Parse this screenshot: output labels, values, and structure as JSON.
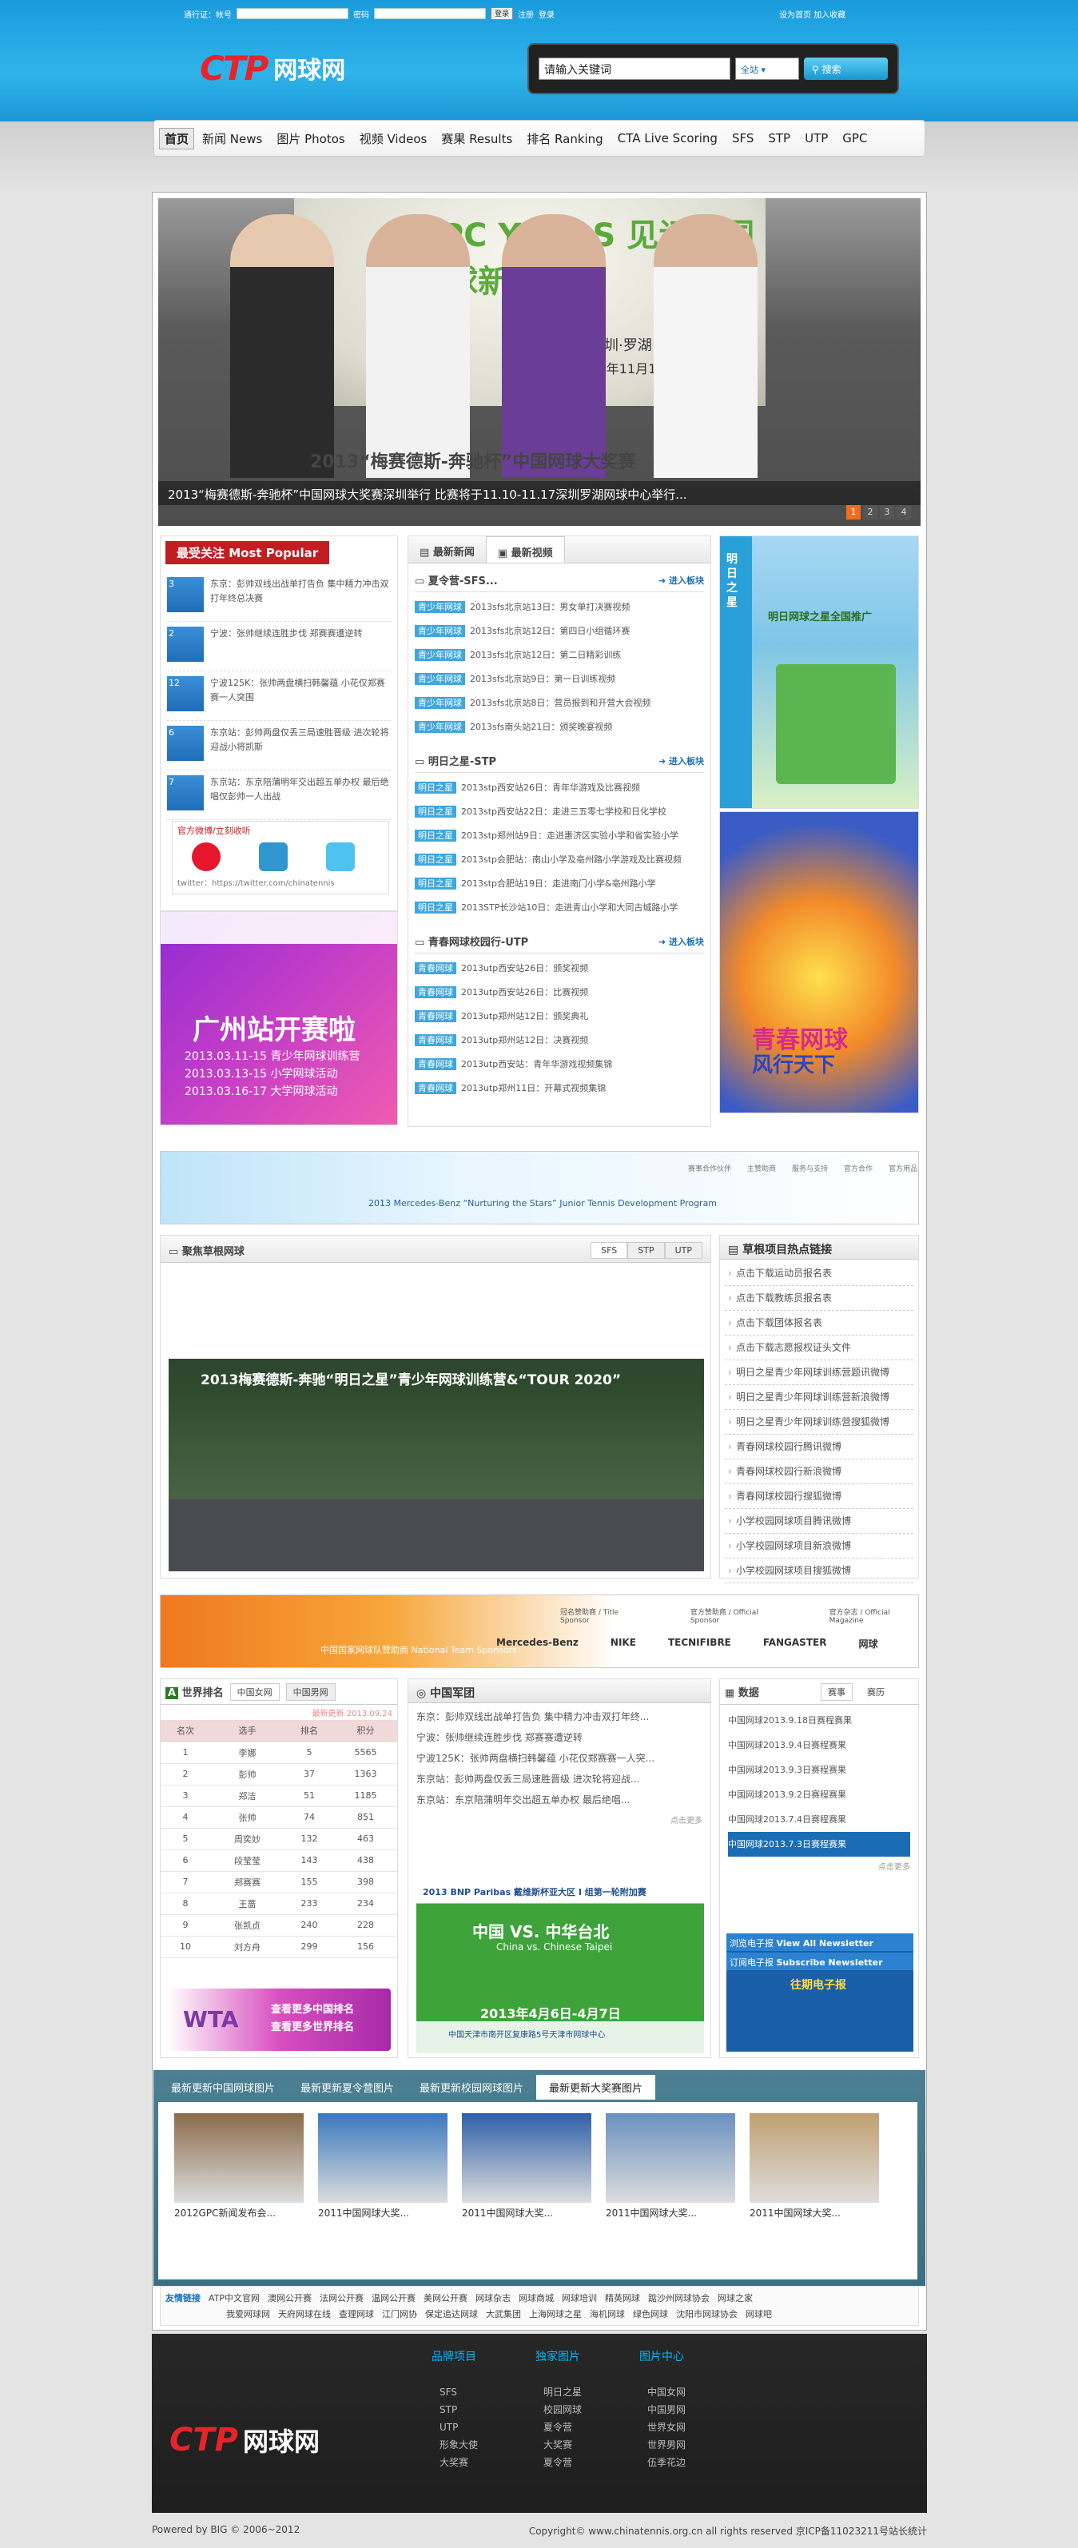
{
  "top": {
    "login_label": "通行证：帐号",
    "password_label": "密码",
    "login_btn": "登录",
    "register": "注册",
    "login": "登录",
    "set_home": "设为首页",
    "add_fav": "加入收藏"
  },
  "logo": {
    "text_ctp": "CTP",
    "text_cn": "网球网"
  },
  "search": {
    "value": "请输入关键词",
    "scope": "全站",
    "button": "搜索"
  },
  "nav": [
    "首页",
    "新闻 News",
    "图片 Photos",
    "视频 Videos",
    "赛果 Results",
    "排名 Ranking",
    "CTA Live Scoring",
    "SFS",
    "STP",
    "UTP",
    "GPC"
  ],
  "slide": {
    "caption": "2013“梅赛德斯-奔驰杯”中国网球大奖赛深圳举行 比赛将于11.10-11.17深圳罗湖网球中心举行...",
    "banner_title": "GPC YEARS 见证中国网球新力量",
    "banner_sub": "深圳·罗湖",
    "banner_date": "2013年11月10日",
    "banner_bottom": "2013“梅赛德斯-奔驰杯”中国网球大奖赛",
    "pages": [
      "1",
      "2",
      "3",
      "4"
    ]
  },
  "popular": {
    "title": "最受关注 Most Popular",
    "items": [
      {
        "num": "3",
        "text": "东京：彭帅双线出战单打告负 集中精力冲击双打年终总决赛"
      },
      {
        "num": "2",
        "text": "宁波：张帅继续连胜步伐 郑赛赛遭逆转"
      },
      {
        "num": "12",
        "text": "宁波125K：张帅两盘横扫韩馨蕴 小花仅郑赛赛一人突围"
      },
      {
        "num": "6",
        "text": "东京站：彭帅两盘仅丢三局速胜晋级 进次轮将迎战小将凯斯"
      },
      {
        "num": "7",
        "text": "东京站：东京陪蒲明年交出超五单办权 最后绝唱仅彭帅一人出战"
      }
    ]
  },
  "weibo": {
    "title": "官方微博/立刻收听",
    "twitter": "twitter：https://twitter.com/chinatennis"
  },
  "guangzhou": {
    "title": "广州站开赛啦",
    "l1": "2013.03.11-15 青少年网球训练营",
    "l2": "2013.03.13-15 小学网球活动",
    "l3": "2013.03.16-17 大学网球活动"
  },
  "center_tabs": {
    "news": "最新新闻",
    "video": "最新视频"
  },
  "sfs": {
    "title": "夏令营-SFS...",
    "enter": "进入板块",
    "rows": [
      {
        "d": "青少年网球",
        "t": "2013sfs北京站13日：男女单打决赛视频"
      },
      {
        "d": "青少年网球",
        "t": "2013sfs北京站12日：第四日小组循环赛"
      },
      {
        "d": "青少年网球",
        "t": "2013sfs北京站12日：第二日精彩训练"
      },
      {
        "d": "青少年网球",
        "t": "2013sfs北京站9日：第一日训练视频"
      },
      {
        "d": "青少年网球",
        "t": "2013sfs北京站8日：营员报到和开营大会视频"
      },
      {
        "d": "青少年网球",
        "t": "2013sfs南头站21日：颁奖晚宴视频"
      }
    ]
  },
  "stp": {
    "title": "明日之星-STP",
    "enter": "进入板块",
    "rows": [
      {
        "d": "明日之星",
        "t": "2013stp西安站26日：青年华游戏及比赛视频"
      },
      {
        "d": "明日之星",
        "t": "2013stp西安站22日：走进三五零七学校和日化学校"
      },
      {
        "d": "明日之星",
        "t": "2013stp郑州站9日：走进惠济区实验小学和省实验小学"
      },
      {
        "d": "明日之星",
        "t": "2013stp会肥站：南山小学及亳州路小学游戏及比赛视频"
      },
      {
        "d": "明日之星",
        "t": "2013stp合肥站19日：走进南门小学&亳州路小学"
      },
      {
        "d": "明日之星",
        "t": "2013STP长沙站10日：走进青山小学和大同古城路小学"
      }
    ]
  },
  "utp": {
    "title": "青春网球校园行-UTP",
    "enter": "进入板块",
    "rows": [
      {
        "d": "青春网球",
        "t": "2013utp西安站26日：颁奖视频"
      },
      {
        "d": "青春网球",
        "t": "2013utp西安站26日：比赛视频"
      },
      {
        "d": "青春网球",
        "t": "2013utp郑州站12日：颁奖典礼"
      },
      {
        "d": "青春网球",
        "t": "2013utp郑州站12日：决赛视频"
      },
      {
        "d": "青春网球",
        "t": "2013utp西安站：青年华游戏视频集锦"
      },
      {
        "d": "青春网球",
        "t": "2013utp郑州11日：开幕式视频集锦"
      }
    ]
  },
  "right_ads": {
    "stp_title": "明日之星",
    "stp_sub": "明日网球之星全国推广",
    "utp_title": "青春网球",
    "utp_title2": "风行天下"
  },
  "sponsor_banner": {
    "text": "2013 Mercedes-Benz “Nurturing the Stars” Junior Tennis Development Program",
    "labels": [
      "赛事合作伙伴",
      "主赞助商",
      "服务与支持",
      "官方合作",
      "官方用品"
    ]
  },
  "focus": {
    "title": "聚焦草根网球",
    "tabs": [
      "SFS",
      "STP",
      "UTP"
    ],
    "image_title": "2013梅赛德斯-奔驰“明日之星”青少年网球训练营&“TOUR 2020”"
  },
  "hot": {
    "title": "草根项目热点链接",
    "links": [
      "点击下载运动员报名表",
      "点击下载教练员报名表",
      "点击下载团体报名表",
      "点击下载志愿报权证头文件",
      "明日之星青少年网球训练营题讯微博",
      "明日之星青少年网球训练营新浪微博",
      "明日之星青少年网球训练营搜狐微博",
      "青春网球校园行腾讯微博",
      "青春网球校园行新浪微博",
      "青春网球校园行搜狐微博",
      "小学校园网球项目腾讯微博",
      "小学校园网球项目新浪微博",
      "小学校园网球项目搜狐微博"
    ]
  },
  "sponsor2": {
    "l1": "冠名赞助商 / Title Sponsor",
    "l2": "官方赞助商 / Official Sponsor",
    "l3": "官方杂志 / Official Magazine",
    "team": "中国国家网球队赞助商 National Team Sponsors",
    "brands": [
      "Mercedes-Benz",
      "NIKE",
      "TECNIFIBRE",
      "FANGASTER",
      "网球"
    ]
  },
  "ranking": {
    "title": "世界排名",
    "tabs": [
      "中国女网",
      "中国男网"
    ],
    "updated": "最新更新 2013.09.24",
    "headers": [
      "名次",
      "选手",
      "排名",
      "积分"
    ],
    "rows": [
      [
        "1",
        "李娜",
        "5",
        "5565"
      ],
      [
        "2",
        "彭帅",
        "37",
        "1363"
      ],
      [
        "3",
        "郑洁",
        "51",
        "1185"
      ],
      [
        "4",
        "张帅",
        "74",
        "851"
      ],
      [
        "5",
        "周奕妙",
        "132",
        "463"
      ],
      [
        "6",
        "段莹莹",
        "143",
        "438"
      ],
      [
        "7",
        "郑赛赛",
        "155",
        "398"
      ],
      [
        "8",
        "王蔷",
        "233",
        "234"
      ],
      [
        "9",
        "张凯贞",
        "240",
        "228"
      ],
      [
        "10",
        "刘方舟",
        "299",
        "156"
      ]
    ],
    "wta1": "查看更多中国排名",
    "wta2": "查看更多世界排名"
  },
  "army": {
    "title": "中国军团",
    "items": [
      "东京：彭帅双线出战单打告负 集中精力冲击双打年终...",
      "宁波：张帅继续连胜步伐 郑赛赛遭逆转",
      "宁波125K：张帅两盘横扫韩馨蕴 小花仅郑赛赛一人突...",
      "东京站：彭帅两盘仅丢三局速胜晋级 进次轮将迎战...",
      "东京站：东京陪蒲明年交出超五单办权 最后绝唱..."
    ],
    "more": "点击更多",
    "davis_title": "2013 BNP Paribas 戴维斯杯亚大区 I 组第一轮附加赛",
    "davis_vs": "中国 VS. 中华台北",
    "davis_en": "China vs. Chinese Taipei",
    "davis_date": "2013年4月6日-4月7日",
    "davis_place": "中国天津市南开区复康路5号天津市网球中心"
  },
  "data": {
    "title": "数据",
    "tabs": [
      "赛事",
      "赛历"
    ],
    "items": [
      "中国网球2013.9.18日赛程赛果",
      "中国网球2013.9.4日赛程赛果",
      "中国网球2013.9.3日赛程赛果",
      "中国网球2013.9.2日赛程赛果",
      "中国网球2013.7.4日赛程赛果",
      "中国网球2013.7.3日赛程赛果"
    ],
    "more": "点击更多",
    "nl1": "浏览电子报",
    "nl1b": "View All Newsletter",
    "nl2": "订阅电子报",
    "nl2b": "Subscribe Newsletter",
    "eb": "往期电子报"
  },
  "photos": {
    "tabs": [
      "最新更新中国网球图片",
      "最新更新夏令营图片",
      "最新更新校园网球图片",
      "最新更新大奖赛图片"
    ],
    "items": [
      "2012GPC新闻发布会...",
      "2011中国网球大奖...",
      "2011中国网球大奖...",
      "2011中国网球大奖...",
      "2011中国网球大奖..."
    ]
  },
  "links": {
    "title": "友情链接",
    "row1": [
      "ATP中文官网",
      "澳网公开赛",
      "法网公开赛",
      "温网公开赛",
      "美网公开赛",
      "网球杂志",
      "网球商城",
      "网球培训",
      "精英网球",
      "踮沙州网球协会",
      "网球之家"
    ],
    "row2": [
      "我爱网球网",
      "天府网球在线",
      "查理网球",
      "江门网协",
      "保定追达网球",
      "大武集团",
      "上海网球之星",
      "海机网球",
      "绿色网球",
      "沈阳市网球协会",
      "网球吧"
    ]
  },
  "footer": {
    "h1": "品牌项目",
    "h2": "独家图片",
    "h3": "图片中心",
    "c1": [
      "SFS",
      "STP",
      "UTP",
      "形象大使",
      "大奖赛"
    ],
    "c2": [
      "明日之星",
      "校园网球",
      "夏令营",
      "大奖赛",
      "夏令营"
    ],
    "c3": [
      "中国女网",
      "中国男网",
      "世界女网",
      "世界男网",
      "伍季花边"
    ],
    "logo_ctp": "CTP",
    "logo_cn": "网球网"
  },
  "bottom": {
    "left": "Powered by BIG © 2006~2012",
    "right": "Copyright© www.chinatennis.org.cn all rights reserved 京ICP备11023211号站长统计"
  }
}
